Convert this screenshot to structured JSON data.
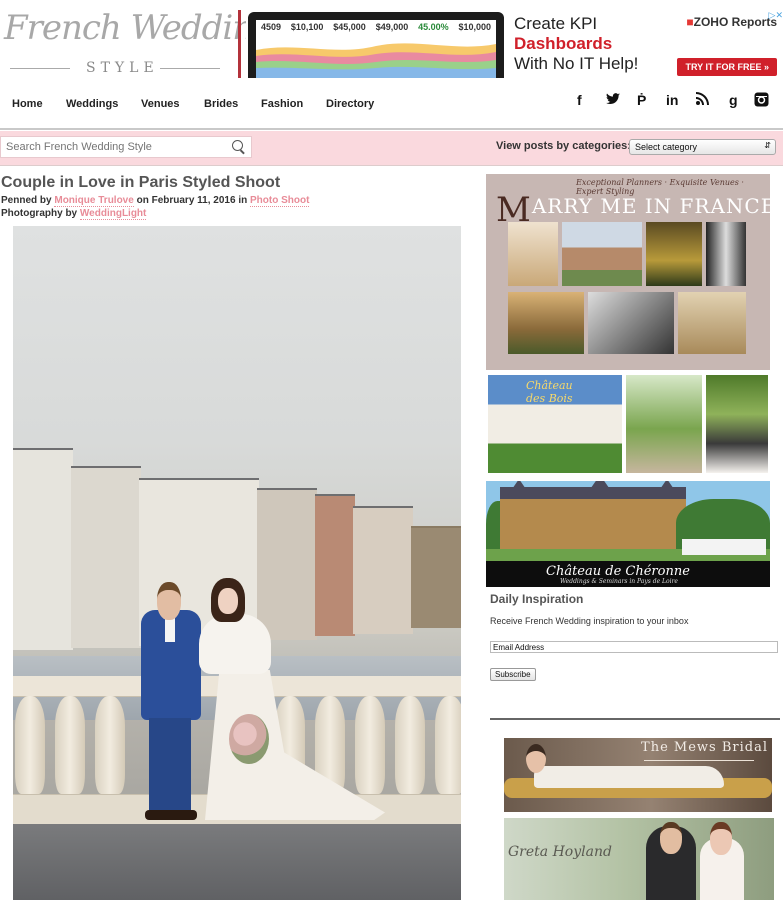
{
  "logo": {
    "name": "French Wedding",
    "style_word": "STYLE"
  },
  "ad": {
    "kpis": [
      "4509",
      "$10,100",
      "$45,000",
      "$49,000",
      "45.00%",
      "$10,000"
    ],
    "line1": "Create KPI",
    "line2": "Dashboards",
    "line3": "With No IT Help!",
    "brand": "ZOHO",
    "brand_suffix": " Reports",
    "cta": "TRY IT FOR FREE",
    "ad_marker": "▷✕"
  },
  "nav": {
    "items": [
      "Home",
      "Weddings",
      "Venues",
      "Brides",
      "Fashion",
      "Directory"
    ]
  },
  "social_icons": [
    "facebook-icon",
    "twitter-icon",
    "pinterest-icon",
    "linkedin-icon",
    "rss-icon",
    "google-plus-icon",
    "instagram-icon"
  ],
  "search": {
    "placeholder": "Search French Wedding Style"
  },
  "categories": {
    "label": "View posts by categories:",
    "selected": "Select category"
  },
  "post": {
    "title": "Couple in Love in Paris Styled Shoot",
    "penned_by": "Penned by",
    "author": "Monique Trulove",
    "on": "on February 11, 2016 in",
    "category": "Photo Shoot",
    "photo_by": "Photography by",
    "photographer": "WeddingLight"
  },
  "sidebar": {
    "marry_me": {
      "brand_m": "M",
      "brand_rest": "ARRY ME IN FRANCE",
      "tagline": "Exceptional Planners · Exquisite Venues · Expert Styling"
    },
    "chateau_des_bois": {
      "title_line1": "Château",
      "title_line2": "des Bois"
    },
    "cheronne": {
      "name": "Château de Chéronne",
      "subtitle": "Weddings & Seminars in Pays de Loire"
    },
    "daily": {
      "title": "Daily Inspiration",
      "text": "Receive French Wedding inspiration to your inbox",
      "email_value": "Email Address",
      "subscribe_label": "Subscribe"
    },
    "mews": {
      "title": "The Mews Bridal"
    },
    "greta": {
      "script": "Greta Hoyland"
    }
  },
  "colors": {
    "accent_pink": "#fad9de",
    "link_pink": "#e88c98",
    "ad_red": "#d0202a",
    "logo_rule": "#b3323b"
  }
}
